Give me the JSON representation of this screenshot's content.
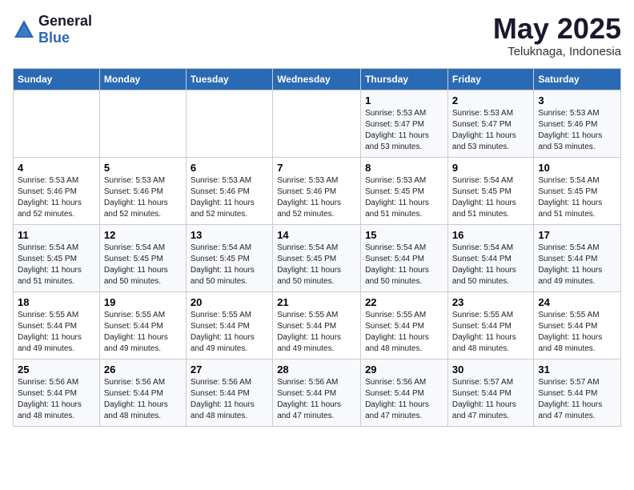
{
  "logo": {
    "general": "General",
    "blue": "Blue"
  },
  "title": "May 2025",
  "location": "Teluknaga, Indonesia",
  "days_of_week": [
    "Sunday",
    "Monday",
    "Tuesday",
    "Wednesday",
    "Thursday",
    "Friday",
    "Saturday"
  ],
  "weeks": [
    [
      {
        "day": "",
        "sunrise": "",
        "sunset": "",
        "daylight": ""
      },
      {
        "day": "",
        "sunrise": "",
        "sunset": "",
        "daylight": ""
      },
      {
        "day": "",
        "sunrise": "",
        "sunset": "",
        "daylight": ""
      },
      {
        "day": "",
        "sunrise": "",
        "sunset": "",
        "daylight": ""
      },
      {
        "day": "1",
        "sunrise": "Sunrise: 5:53 AM",
        "sunset": "Sunset: 5:47 PM",
        "daylight": "Daylight: 11 hours and 53 minutes."
      },
      {
        "day": "2",
        "sunrise": "Sunrise: 5:53 AM",
        "sunset": "Sunset: 5:47 PM",
        "daylight": "Daylight: 11 hours and 53 minutes."
      },
      {
        "day": "3",
        "sunrise": "Sunrise: 5:53 AM",
        "sunset": "Sunset: 5:46 PM",
        "daylight": "Daylight: 11 hours and 53 minutes."
      }
    ],
    [
      {
        "day": "4",
        "sunrise": "Sunrise: 5:53 AM",
        "sunset": "Sunset: 5:46 PM",
        "daylight": "Daylight: 11 hours and 52 minutes."
      },
      {
        "day": "5",
        "sunrise": "Sunrise: 5:53 AM",
        "sunset": "Sunset: 5:46 PM",
        "daylight": "Daylight: 11 hours and 52 minutes."
      },
      {
        "day": "6",
        "sunrise": "Sunrise: 5:53 AM",
        "sunset": "Sunset: 5:46 PM",
        "daylight": "Daylight: 11 hours and 52 minutes."
      },
      {
        "day": "7",
        "sunrise": "Sunrise: 5:53 AM",
        "sunset": "Sunset: 5:46 PM",
        "daylight": "Daylight: 11 hours and 52 minutes."
      },
      {
        "day": "8",
        "sunrise": "Sunrise: 5:53 AM",
        "sunset": "Sunset: 5:45 PM",
        "daylight": "Daylight: 11 hours and 51 minutes."
      },
      {
        "day": "9",
        "sunrise": "Sunrise: 5:54 AM",
        "sunset": "Sunset: 5:45 PM",
        "daylight": "Daylight: 11 hours and 51 minutes."
      },
      {
        "day": "10",
        "sunrise": "Sunrise: 5:54 AM",
        "sunset": "Sunset: 5:45 PM",
        "daylight": "Daylight: 11 hours and 51 minutes."
      }
    ],
    [
      {
        "day": "11",
        "sunrise": "Sunrise: 5:54 AM",
        "sunset": "Sunset: 5:45 PM",
        "daylight": "Daylight: 11 hours and 51 minutes."
      },
      {
        "day": "12",
        "sunrise": "Sunrise: 5:54 AM",
        "sunset": "Sunset: 5:45 PM",
        "daylight": "Daylight: 11 hours and 50 minutes."
      },
      {
        "day": "13",
        "sunrise": "Sunrise: 5:54 AM",
        "sunset": "Sunset: 5:45 PM",
        "daylight": "Daylight: 11 hours and 50 minutes."
      },
      {
        "day": "14",
        "sunrise": "Sunrise: 5:54 AM",
        "sunset": "Sunset: 5:45 PM",
        "daylight": "Daylight: 11 hours and 50 minutes."
      },
      {
        "day": "15",
        "sunrise": "Sunrise: 5:54 AM",
        "sunset": "Sunset: 5:44 PM",
        "daylight": "Daylight: 11 hours and 50 minutes."
      },
      {
        "day": "16",
        "sunrise": "Sunrise: 5:54 AM",
        "sunset": "Sunset: 5:44 PM",
        "daylight": "Daylight: 11 hours and 50 minutes."
      },
      {
        "day": "17",
        "sunrise": "Sunrise: 5:54 AM",
        "sunset": "Sunset: 5:44 PM",
        "daylight": "Daylight: 11 hours and 49 minutes."
      }
    ],
    [
      {
        "day": "18",
        "sunrise": "Sunrise: 5:55 AM",
        "sunset": "Sunset: 5:44 PM",
        "daylight": "Daylight: 11 hours and 49 minutes."
      },
      {
        "day": "19",
        "sunrise": "Sunrise: 5:55 AM",
        "sunset": "Sunset: 5:44 PM",
        "daylight": "Daylight: 11 hours and 49 minutes."
      },
      {
        "day": "20",
        "sunrise": "Sunrise: 5:55 AM",
        "sunset": "Sunset: 5:44 PM",
        "daylight": "Daylight: 11 hours and 49 minutes."
      },
      {
        "day": "21",
        "sunrise": "Sunrise: 5:55 AM",
        "sunset": "Sunset: 5:44 PM",
        "daylight": "Daylight: 11 hours and 49 minutes."
      },
      {
        "day": "22",
        "sunrise": "Sunrise: 5:55 AM",
        "sunset": "Sunset: 5:44 PM",
        "daylight": "Daylight: 11 hours and 48 minutes."
      },
      {
        "day": "23",
        "sunrise": "Sunrise: 5:55 AM",
        "sunset": "Sunset: 5:44 PM",
        "daylight": "Daylight: 11 hours and 48 minutes."
      },
      {
        "day": "24",
        "sunrise": "Sunrise: 5:55 AM",
        "sunset": "Sunset: 5:44 PM",
        "daylight": "Daylight: 11 hours and 48 minutes."
      }
    ],
    [
      {
        "day": "25",
        "sunrise": "Sunrise: 5:56 AM",
        "sunset": "Sunset: 5:44 PM",
        "daylight": "Daylight: 11 hours and 48 minutes."
      },
      {
        "day": "26",
        "sunrise": "Sunrise: 5:56 AM",
        "sunset": "Sunset: 5:44 PM",
        "daylight": "Daylight: 11 hours and 48 minutes."
      },
      {
        "day": "27",
        "sunrise": "Sunrise: 5:56 AM",
        "sunset": "Sunset: 5:44 PM",
        "daylight": "Daylight: 11 hours and 48 minutes."
      },
      {
        "day": "28",
        "sunrise": "Sunrise: 5:56 AM",
        "sunset": "Sunset: 5:44 PM",
        "daylight": "Daylight: 11 hours and 47 minutes."
      },
      {
        "day": "29",
        "sunrise": "Sunrise: 5:56 AM",
        "sunset": "Sunset: 5:44 PM",
        "daylight": "Daylight: 11 hours and 47 minutes."
      },
      {
        "day": "30",
        "sunrise": "Sunrise: 5:57 AM",
        "sunset": "Sunset: 5:44 PM",
        "daylight": "Daylight: 11 hours and 47 minutes."
      },
      {
        "day": "31",
        "sunrise": "Sunrise: 5:57 AM",
        "sunset": "Sunset: 5:44 PM",
        "daylight": "Daylight: 11 hours and 47 minutes."
      }
    ]
  ]
}
